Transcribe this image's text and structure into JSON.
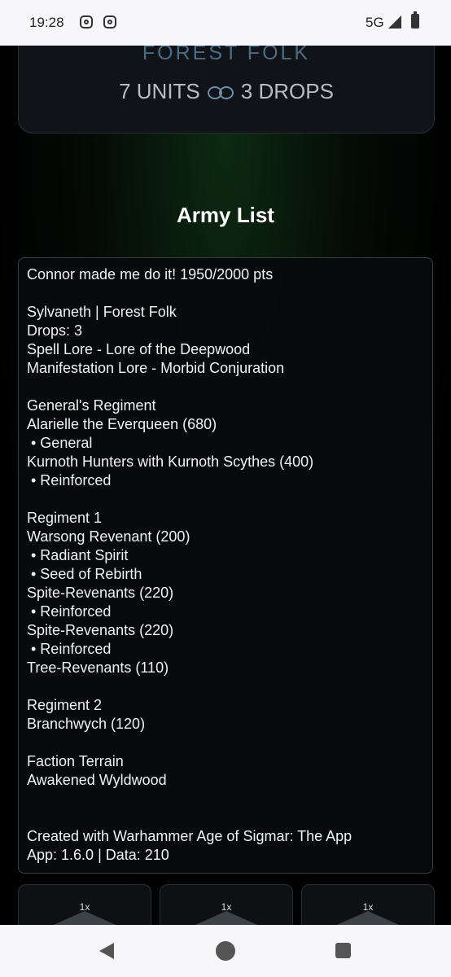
{
  "status_bar": {
    "time": "19:28",
    "network": "5G",
    "icons": [
      "instagram-icon",
      "instagram-icon",
      "signal-icon",
      "battery-icon"
    ]
  },
  "hero": {
    "faction": "FOREST FOLK",
    "units": "7 UNITS",
    "drops": "3 DROPS"
  },
  "section_title": "Army List",
  "army_list_text": "Connor made me do it! 1950/2000 pts\n\nSylvaneth | Forest Folk\nDrops: 3\nSpell Lore - Lore of the Deepwood\nManifestation Lore - Morbid Conjuration\n\nGeneral's Regiment\nAlarielle the Everqueen (680)\n • General\nKurnoth Hunters with Kurnoth Scythes (400)\n • Reinforced\n\nRegiment 1\nWarsong Revenant (200)\n • Radiant Spirit\n • Seed of Rebirth\nSpite-Revenants (220)\n • Reinforced\nSpite-Revenants (220)\n • Reinforced\nTree-Revenants (110)\n\nRegiment 2\nBranchwych (120)\n\nFaction Terrain\nAwakened Wyldwood\n\n\nCreated with Warhammer Age of Sigmar: The App\nApp: 1.6.0 | Data: 210",
  "unit_tiles": [
    {
      "count": "1x"
    },
    {
      "count": "1x"
    },
    {
      "count": "1x"
    }
  ],
  "nav_bar": {
    "buttons": [
      "back",
      "home",
      "recents"
    ]
  },
  "colors": {
    "faction_text": "#4a6b86",
    "background": "#000000",
    "status_bar": "#f7f7f9"
  }
}
